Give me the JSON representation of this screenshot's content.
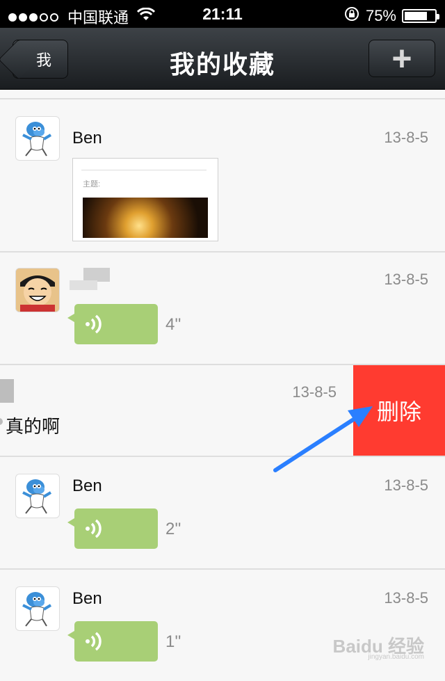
{
  "status_bar": {
    "carrier": "中国联通",
    "time": "21:11",
    "battery": "75%",
    "battery_level": 0.75
  },
  "nav": {
    "back_label": "我",
    "title": "我的收藏",
    "add_label": "+"
  },
  "favorites": [
    {
      "sender": "Ben",
      "date": "13-8-5",
      "type": "image",
      "thumb_caption": "主题:"
    },
    {
      "sender": "",
      "date": "13-8-5",
      "type": "voice",
      "duration": "4''"
    },
    {
      "sender": "",
      "date": "13-8-5",
      "type": "text",
      "text": "真的啊",
      "swiped": true,
      "delete_label": "删除"
    },
    {
      "sender": "Ben",
      "date": "13-8-5",
      "type": "voice",
      "duration": "2''"
    },
    {
      "sender": "Ben",
      "date": "13-8-5",
      "type": "voice",
      "duration": "1''"
    }
  ],
  "watermark": {
    "text": "Baidu 经验",
    "sub": "jingyan.baidu.com"
  },
  "colors": {
    "nav_bg": "#2b2f33",
    "voice_bubble": "#a8cf76",
    "delete_bg": "#ff3b30",
    "annotation_arrow": "#2a7fff"
  },
  "icons": {
    "avatar_ben": "smurf-avatar",
    "avatar_other": "luffy-avatar",
    "voice": "sound-wave-icon",
    "wifi": "wifi-icon",
    "lock": "rotation-lock-icon",
    "battery": "battery-icon"
  }
}
